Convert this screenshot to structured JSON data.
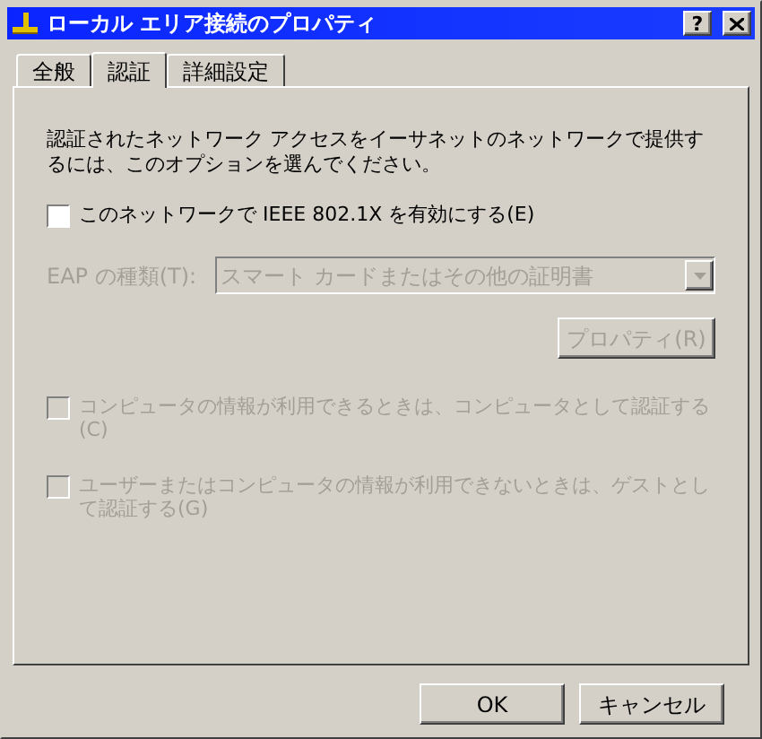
{
  "window": {
    "title": "ローカル エリア接続のプロパティ",
    "help_button": "?"
  },
  "tabs": [
    {
      "label": "全般",
      "selected": false
    },
    {
      "label": "認証",
      "selected": true
    },
    {
      "label": "詳細設定",
      "selected": false
    }
  ],
  "description": "認証されたネットワーク アクセスをイーサネットのネットワークで提供するには、このオプションを選んでください。",
  "enable_checkbox": {
    "label": "このネットワークで IEEE 802.1X を有効にする(E)",
    "checked": false,
    "disabled": false
  },
  "eap": {
    "label": "EAP の種類(T):",
    "value": "スマート カードまたはその他の証明書",
    "disabled": true
  },
  "properties_button": {
    "label": "プロパティ(R)",
    "disabled": true
  },
  "options": [
    {
      "label": "コンピュータの情報が利用できるときは、コンピュータとして認証する(C)",
      "checked": false,
      "disabled": true
    },
    {
      "label": "ユーザーまたはコンピュータの情報が利用できないときは、ゲストとして認証する(G)",
      "checked": false,
      "disabled": true
    }
  ],
  "buttons": [
    "OK",
    "キャンセル"
  ]
}
